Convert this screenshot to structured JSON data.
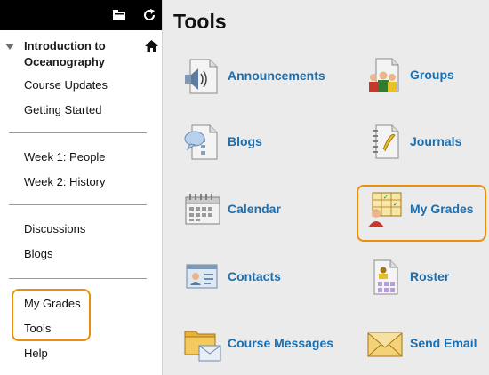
{
  "sidebar": {
    "course_title": "Introduction to Oceanography",
    "items_group1": [
      "Course Updates",
      "Getting Started"
    ],
    "items_group2": [
      "Week 1: People",
      "Week 2: History"
    ],
    "items_group3": [
      "Discussions",
      "Blogs"
    ],
    "items_group4": [
      "My Grades",
      "Tools",
      "Help"
    ]
  },
  "main": {
    "title": "Tools",
    "tools_left": [
      "Announcements",
      "Blogs",
      "Calendar",
      "Contacts",
      "Course Messages"
    ],
    "tools_right": [
      "Groups",
      "Journals",
      "My Grades",
      "Roster",
      "Send Email"
    ]
  },
  "colors": {
    "highlight": "#e8900c",
    "link": "#1a6fb1",
    "sidebar_bar": "#000000"
  }
}
